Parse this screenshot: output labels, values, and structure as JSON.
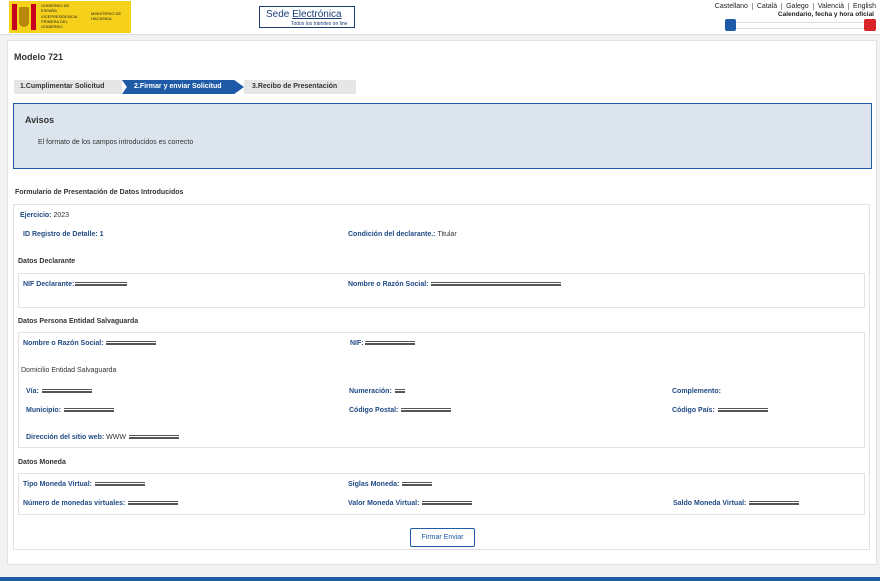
{
  "header": {
    "logo_line1": "VICEPRESIDENCIA PRIMERA DEL GOBIERNO",
    "logo_line2": "MINISTERIO DE HACIENDA",
    "logo_gob": "GOBIERNO DE ESPAÑA",
    "sede_title_a": "Sede",
    "sede_title_b": "Electrónica",
    "sede_sub": "Todos los trámites on line",
    "languages": [
      "Castellano",
      "Català",
      "Galego",
      "Valencià",
      "English"
    ],
    "calendar_label": "Calendario, fecha y hora oficial"
  },
  "page": {
    "title": "Modelo 721",
    "steps": [
      "1.Cumplimentar Solicitud",
      "2.Firmar y enviar Solicitud",
      "3.Recibo de Presentación"
    ],
    "active_step": 1
  },
  "avisos": {
    "heading": "Avisos",
    "message": "El formato de los campos introducidos es correcto"
  },
  "form": {
    "title": "Formulario de Presentación de Datos Introducidos",
    "ejercicio_label": "Ejercicio:",
    "ejercicio_value": "2023",
    "id_registro_label": "ID Registro de Detalle:",
    "id_registro_value": "1",
    "condicion_label": "Condición del declarante.:",
    "condicion_value": "Titular",
    "declarante_section": "Datos Declarante",
    "nif_declarante_label": "NIF Declarante:",
    "nombre_razon_label": "Nombre o Razón Social:",
    "persona_section": "Datos Persona Entidad Salvaguarda",
    "persona_nombre_label": "Nombre o Razón Social:",
    "persona_nif_label": "NIF:",
    "domicilio_section": "Domicilio Entidad Salvaguarda",
    "via_label": "Vía:",
    "numeracion_label": "Numeración:",
    "complemento_label": "Complemento:",
    "municipio_label": "Municipio:",
    "codigo_postal_label": "Código Postal:",
    "codigo_pais_label": "Código País:",
    "web_label": "Dirección del sitio web:",
    "web_prefix": "WWW",
    "moneda_section": "Datos Moneda",
    "tipo_moneda_label": "Tipo Moneda Virtual:",
    "siglas_label": "Siglas Moneda:",
    "numero_monedas_label": "Número de monedas virtuales:",
    "valor_moneda_label": "Valor Moneda Virtual:",
    "saldo_moneda_label": "Saldo Moneda Virtual:",
    "submit_label": "Firmar Enviar"
  }
}
